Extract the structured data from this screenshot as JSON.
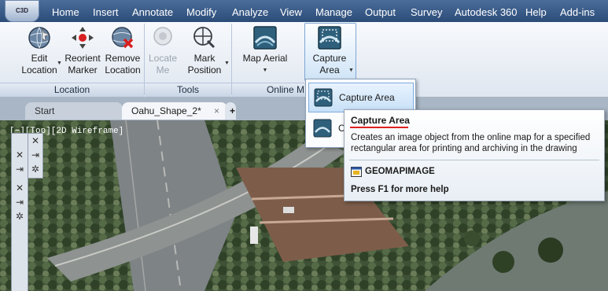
{
  "app": {
    "badge": "C3D"
  },
  "menu": [
    "Home",
    "Insert",
    "Annotate",
    "Modify",
    "Analyze",
    "View",
    "Manage",
    "Output",
    "Survey",
    "Autodesk 360",
    "Help",
    "Add-ins"
  ],
  "ribbon": {
    "buttons": {
      "edit_location": "Edit\nLocation",
      "reorient_marker": "Reorient\nMarker",
      "remove_location": "Remove\nLocation",
      "locate_me": "Locate\nMe",
      "mark_position": "Mark\nPosition",
      "map_aerial": "Map Aerial",
      "capture_area": "Capture\nArea"
    },
    "panels": {
      "location": "Location",
      "tools": "Tools",
      "online_map": "Online M"
    }
  },
  "tabs": {
    "start": "Start",
    "drawing": "Oahu_Shape_2*",
    "close": "×",
    "new": "+"
  },
  "viewport": {
    "label": "[−][Top][2D Wireframe]"
  },
  "dropdown": {
    "item1": "Capture Area",
    "item2": "C"
  },
  "tooltip": {
    "title": "Capture Area",
    "description": "Creates an image object from the online map for a specified rectangular area for printing and archiving in the drawing",
    "command": "GEOMAPIMAGE",
    "help": "Press F1 for more help"
  },
  "colors": {
    "menubar": "#2c4c78",
    "accent_highlight": "#c7e0f8",
    "underline": "#e02020"
  }
}
